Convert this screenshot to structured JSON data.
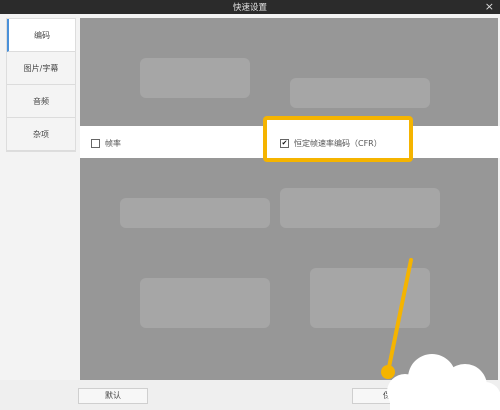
{
  "window": {
    "title": "快速设置",
    "close_glyph": "×"
  },
  "sidebar": {
    "items": [
      {
        "label": "编码",
        "active": true
      },
      {
        "label": "图片/字幕",
        "active": false
      },
      {
        "label": "音频",
        "active": false
      },
      {
        "label": "杂项",
        "active": false
      }
    ]
  },
  "options": {
    "frame_rate": {
      "label": "帧率",
      "checked": false
    },
    "cfr": {
      "label": "恒定帧速率编码（CFR）",
      "checked": true,
      "check_glyph": "✔"
    }
  },
  "footer": {
    "default_label": "默认",
    "save_label": "保"
  },
  "colors": {
    "highlight": "#f5b400",
    "titlebar": "#2b2b2b",
    "overlay": "#979797"
  }
}
